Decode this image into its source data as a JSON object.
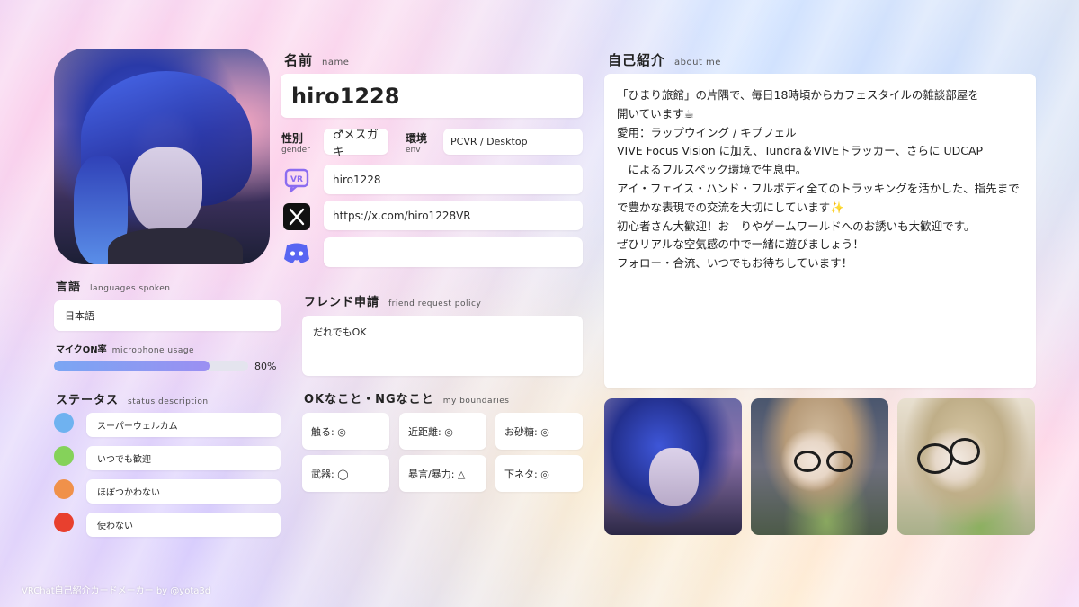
{
  "name": {
    "label_jp": "名前",
    "label_en": "name",
    "value": "hiro1228"
  },
  "gender": {
    "label_jp": "性別",
    "label_en": "gender",
    "value": "♂メスガキ"
  },
  "env": {
    "label_jp": "環境",
    "label_en": "env",
    "value": "PCVR / Desktop"
  },
  "social": {
    "vrchat": {
      "icon": "vrchat-icon",
      "value": "hiro1228"
    },
    "x": {
      "icon": "x-icon",
      "value": "https://x.com/hiro1228VR"
    },
    "discord": {
      "icon": "discord-icon",
      "value": ""
    }
  },
  "languages": {
    "label_jp": "言語",
    "label_en": "languages spoken",
    "value": "日本語"
  },
  "mic": {
    "label_jp": "マイクON率",
    "label_en": "microphone usage",
    "percent": 80,
    "value_text": "80%"
  },
  "status": {
    "label_jp": "ステータス",
    "label_en": "status description",
    "items": [
      {
        "color": "#6fb2f0",
        "text": "スーパーウェルカム"
      },
      {
        "color": "#85d25a",
        "text": "いつでも歓迎"
      },
      {
        "color": "#f0914a",
        "text": "ほぼつかわない"
      },
      {
        "color": "#e8402e",
        "text": "使わない"
      }
    ]
  },
  "friend": {
    "label_jp": "フレンド申請",
    "label_en": "friend request policy",
    "value": "だれでもOK"
  },
  "boundaries": {
    "label_jp": "OKなこと・NGなこと",
    "label_en": "my boundaries",
    "items": [
      "触る: ◎",
      "近距離: ◎",
      "お砂糖: ◎",
      "武器: ◯",
      "暴言/暴力: △",
      "下ネタ: ◎"
    ]
  },
  "about": {
    "label_jp": "自己紹介",
    "label_en": "about me",
    "lines": [
      "「ひまり旅館」の片隅で、毎日18時頃からカフェスタイルの雑談部屋を",
      "開いています☕",
      "愛用：ラップウイング / キプフェル",
      "VIVE Focus Vision に加え、Tundra＆VIVEトラッカー、さらに UDCAP",
      "　によるフルスペック環境で生息中。",
      "アイ・フェイス・ハンド・フルボディ全てのトラッキングを活かした、指先まで",
      "で豊かな表現での交流を大切にしています✨",
      "初心者さん大歓迎！お　りやゲームワールドへのお誘いも大歓迎です。",
      "ぜひリアルな空気感の中で一緒に遊びましょう！",
      "フォロー・合流、いつでもお待ちしています！"
    ]
  },
  "footer": "VRChat自己紹介カードメーカー by @yota3d"
}
